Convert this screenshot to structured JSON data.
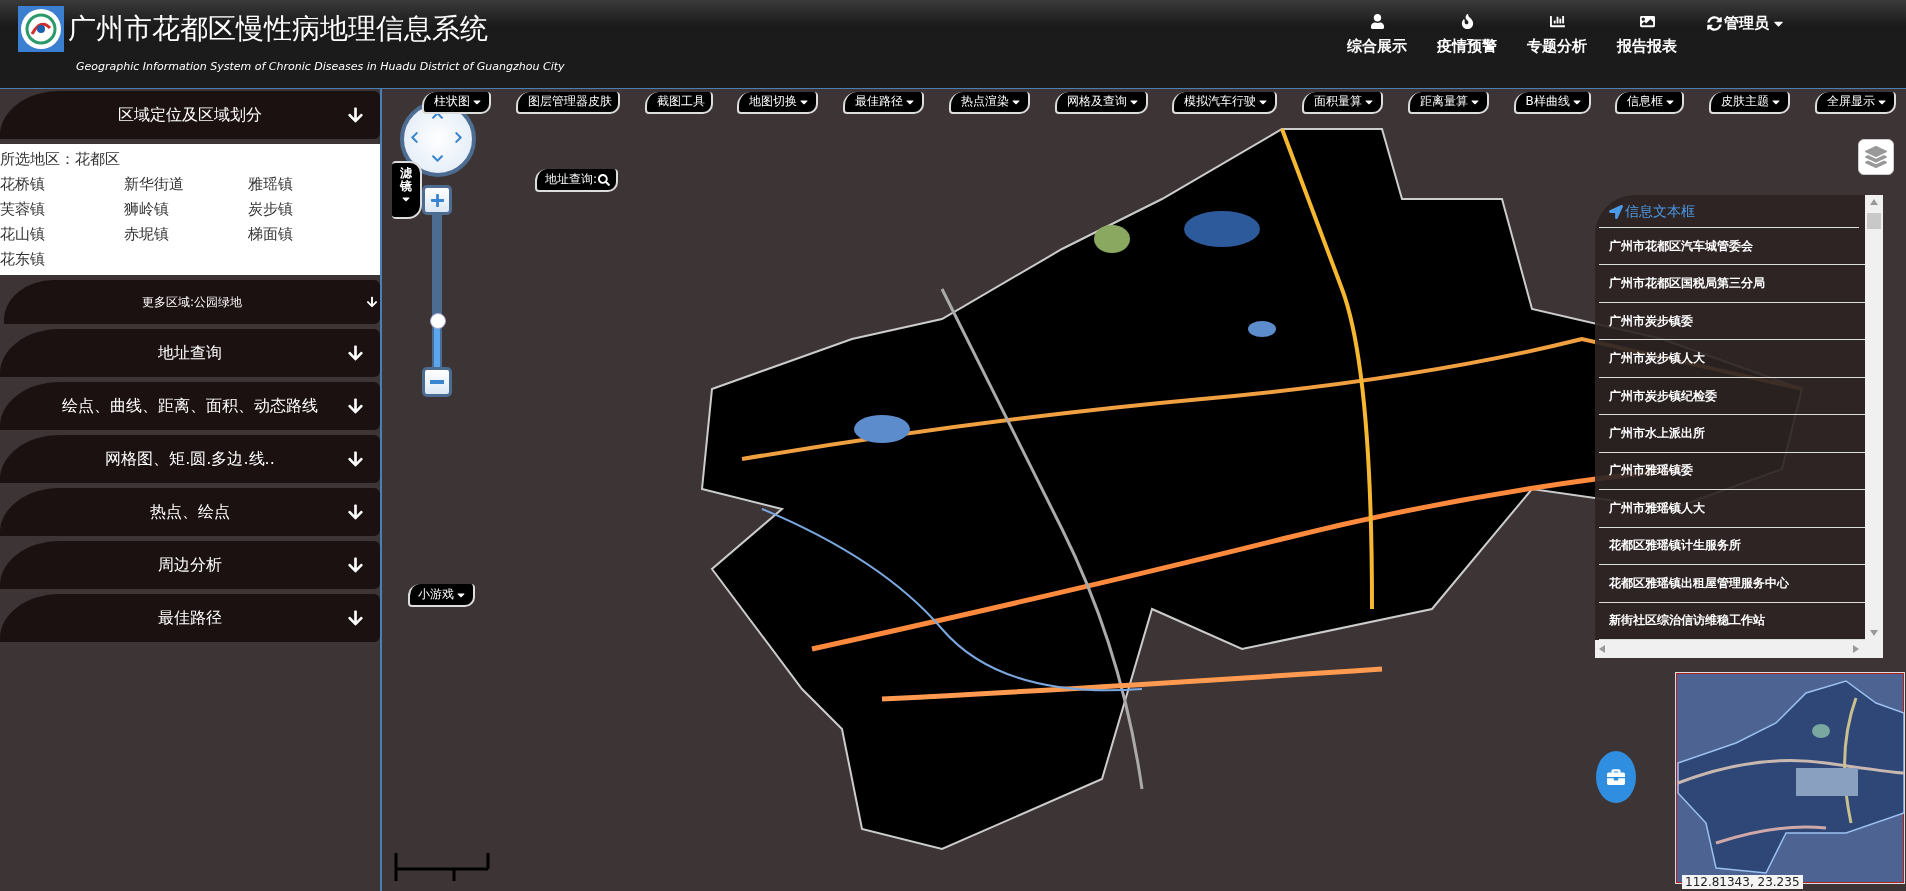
{
  "header": {
    "title": "广州市花都区慢性病地理信息系统",
    "subtitle": "Geographic Information System of Chronic Diseases in Huadu District of Guangzhou City",
    "nav": [
      {
        "label": "综合展示"
      },
      {
        "label": "疫情预警"
      },
      {
        "label": "专题分析"
      },
      {
        "label": "报告报表"
      }
    ],
    "user": {
      "label": "管理员"
    }
  },
  "sidebar": {
    "sections": [
      {
        "title": "区域定位及区域划分",
        "selected_label": "所选地区：",
        "selected_value": "花都区",
        "towns": [
          "花桥镇",
          "新华街道",
          "雅瑶镇",
          "芙蓉镇",
          "狮岭镇",
          "炭步镇",
          "花山镇",
          "赤坭镇",
          "梯面镇",
          "花东镇"
        ],
        "subsection": "更多区域:公园绿地"
      },
      {
        "title": "地址查询"
      },
      {
        "title": "绘点、曲线、距离、面积、动态路线"
      },
      {
        "title": "网格图、矩.圆.多边.线.."
      },
      {
        "title": "热点、绘点"
      },
      {
        "title": "周边分析"
      },
      {
        "title": "最佳路径"
      }
    ]
  },
  "toolbar": [
    {
      "label": "柱状图",
      "dropdown": true
    },
    {
      "label": "图层管理器皮肤",
      "dropdown": false
    },
    {
      "label": "截图工具",
      "dropdown": false
    },
    {
      "label": "地图切换",
      "dropdown": true
    },
    {
      "label": "最佳路径",
      "dropdown": true
    },
    {
      "label": "热点渲染",
      "dropdown": true
    },
    {
      "label": "网格及查询",
      "dropdown": true
    },
    {
      "label": "模拟汽车行驶",
      "dropdown": true
    },
    {
      "label": "面积量算",
      "dropdown": true
    },
    {
      "label": "距离量算",
      "dropdown": true
    },
    {
      "label": "B样曲线",
      "dropdown": true
    },
    {
      "label": "信息框",
      "dropdown": true
    },
    {
      "label": "皮肤主题",
      "dropdown": true
    },
    {
      "label": "全屏显示",
      "dropdown": true
    }
  ],
  "map": {
    "kind": "picture",
    "filter_tab": "滤镜",
    "address_search": "地址查询:",
    "game_button": "小游戏",
    "zoom": {
      "level": 0.3
    },
    "info_box": {
      "title": "信息文本框",
      "items": [
        "广州市花都区汽车城管委会",
        "广州市花都区国税局第三分局",
        "广州市炭步镇委",
        "广州市炭步镇人大",
        "广州市炭步镇纪检委",
        "广州市水上派出所",
        "广州市雅瑶镇委",
        "广州市雅瑶镇人大",
        "花都区雅瑶镇计生服务所",
        "花都区雅瑶镇出租屋管理服务中心",
        "新街社区综治信访维稳工作站"
      ]
    },
    "coordinates": "112.81343, 23.235"
  }
}
